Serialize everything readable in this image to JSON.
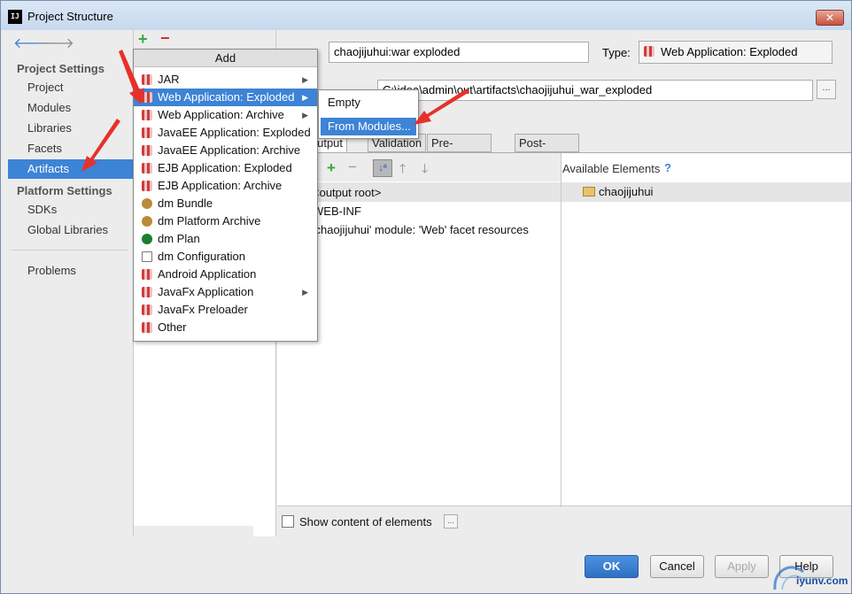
{
  "window": {
    "title": "Project Structure",
    "close_glyph": "✕"
  },
  "sidebar": {
    "back_glyph": "🡐",
    "forward_glyph": "🡒",
    "project_settings_heading": "Project Settings",
    "project_items": [
      "Project",
      "Modules",
      "Libraries",
      "Facets",
      "Artifacts"
    ],
    "selected_item": "Artifacts",
    "platform_settings_heading": "Platform Settings",
    "platform_items": [
      "SDKs",
      "Global Libraries"
    ],
    "problems_label": "Problems"
  },
  "artifact_list": {
    "add_glyph": "+",
    "remove_glyph": "−"
  },
  "content": {
    "name_value": "chaojijuhui:war exploded",
    "type_label": "Type:",
    "type_value": "Web Application: Exploded",
    "output_dir_value": "C:\\idea\\admin\\out\\artifacts\\chaojijuhui_war_exploded",
    "browse_label": "...",
    "tabs": [
      "Output Layout",
      "Validation",
      "Pre-processing",
      "Post-processing"
    ],
    "tree_rows": [
      "<output root>",
      "WEB-INF",
      "'chaojijuhui' module: 'Web' facet resources"
    ],
    "available_elements_label": "Available Elements",
    "available_help": "?",
    "available_items": [
      "chaojijuhui"
    ],
    "show_content_label": "Show content of elements",
    "show_content_btn": "..."
  },
  "popup": {
    "title": "Add",
    "items": [
      {
        "label": "JAR",
        "icon": "gift-icon",
        "submenu": true
      },
      {
        "label": "Web Application: Exploded",
        "icon": "gift-icon",
        "submenu": true,
        "selected": true
      },
      {
        "label": "Web Application: Archive",
        "icon": "gift-icon",
        "submenu": true
      },
      {
        "label": "JavaEE Application: Exploded",
        "icon": "gift-icon",
        "submenu": false
      },
      {
        "label": "JavaEE Application: Archive",
        "icon": "gift-icon",
        "submenu": false
      },
      {
        "label": "EJB Application: Exploded",
        "icon": "gift-icon",
        "submenu": false
      },
      {
        "label": "EJB Application: Archive",
        "icon": "gift-icon",
        "submenu": false
      },
      {
        "label": "dm Bundle",
        "icon": "dm-icon",
        "submenu": false
      },
      {
        "label": "dm Platform Archive",
        "icon": "dm-icon",
        "submenu": false
      },
      {
        "label": "dm Plan",
        "icon": "plan-icon",
        "submenu": false
      },
      {
        "label": "dm Configuration",
        "icon": "doc-icon",
        "submenu": false
      },
      {
        "label": "Android Application",
        "icon": "gift-icon",
        "submenu": false
      },
      {
        "label": "JavaFx Application",
        "icon": "gift-icon",
        "submenu": true
      },
      {
        "label": "JavaFx Preloader",
        "icon": "gift-icon",
        "submenu": false
      },
      {
        "label": "Other",
        "icon": "gift-icon",
        "submenu": false
      }
    ],
    "submenu_glyph": "▶"
  },
  "subpopup": {
    "items": [
      "Empty",
      "From Modules..."
    ],
    "selected": "From Modules..."
  },
  "buttons": {
    "ok": "OK",
    "cancel": "Cancel",
    "apply": "Apply",
    "help": "Help"
  },
  "watermark": {
    "text": "iyunv.com"
  },
  "colors": {
    "selection": "#3d83d6",
    "annotation_arrow": "#e8302a"
  }
}
